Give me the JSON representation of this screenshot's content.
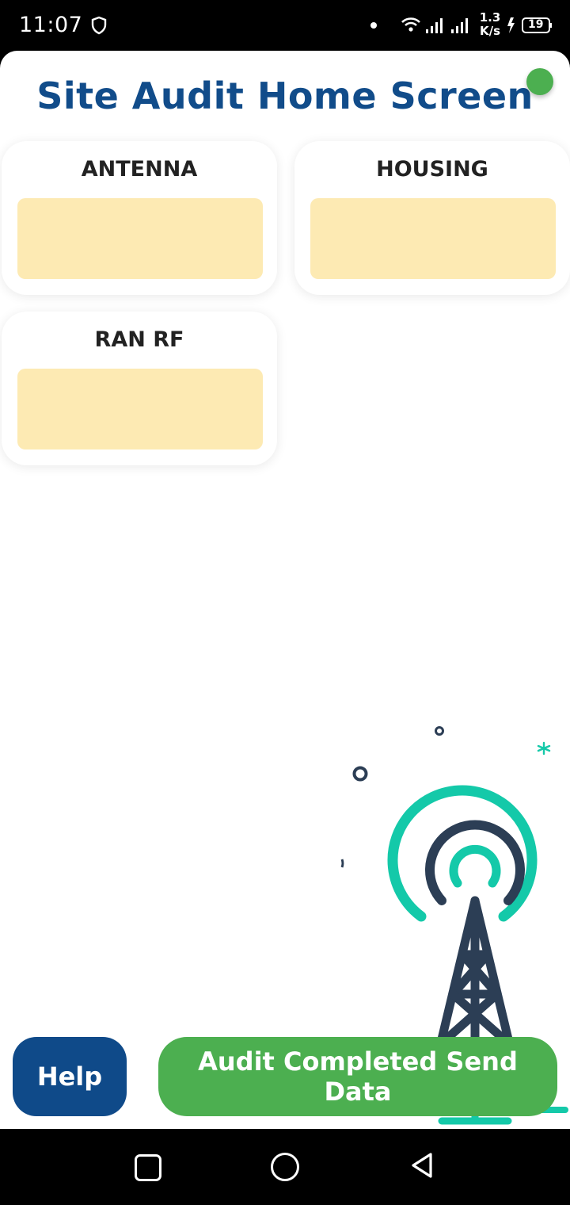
{
  "status_bar": {
    "time": "11:07",
    "net_speed_value": "1.3",
    "net_speed_unit": "K/s",
    "battery": "19"
  },
  "app": {
    "title": "Site Audit Home Screen",
    "status_color": "#4caf50"
  },
  "cards": [
    {
      "label": "ANTENNA"
    },
    {
      "label": "HOUSING"
    },
    {
      "label": "RAN RF"
    }
  ],
  "buttons": {
    "help": "Help",
    "send": "Audit Completed Send Data"
  },
  "colors": {
    "primary": "#114c8a",
    "accent": "#4caf50",
    "card_fill": "#fdeab3",
    "tower_teal": "#14c9a9",
    "tower_navy": "#2c3e55"
  },
  "icons": [
    "shield-icon",
    "wifi-icon",
    "signal-icon",
    "battery-icon",
    "cell-tower-illustration",
    "recent-apps-icon",
    "home-icon",
    "back-icon"
  ]
}
